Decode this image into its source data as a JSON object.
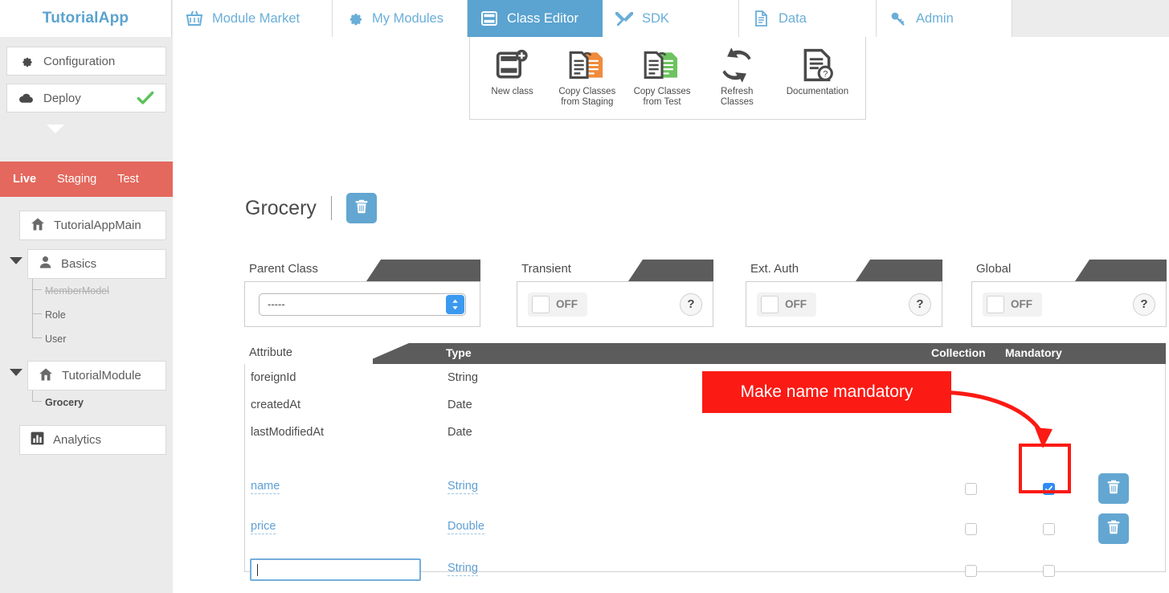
{
  "brand": {
    "name": "TutorialApp"
  },
  "tabs": [
    {
      "label": "Module Market",
      "icon": "basket-icon",
      "active": false
    },
    {
      "label": "My Modules",
      "icon": "gear-icon",
      "active": false
    },
    {
      "label": "Class Editor",
      "icon": "class-icon",
      "active": true
    },
    {
      "label": "SDK",
      "icon": "tools-icon",
      "active": false
    },
    {
      "label": "Data",
      "icon": "document-icon",
      "active": false
    },
    {
      "label": "Admin",
      "icon": "key-icon",
      "active": false
    }
  ],
  "sidebar": {
    "top_items": [
      {
        "label": "Configuration",
        "icon": "gear-icon"
      },
      {
        "label": "Deploy",
        "icon": "cloud-icon",
        "status_icon": "check-icon"
      }
    ],
    "environments": [
      {
        "label": "Live",
        "active": true
      },
      {
        "label": "Staging",
        "active": false
      },
      {
        "label": "Test",
        "active": false
      }
    ],
    "tree": [
      {
        "label": "TutorialAppMain",
        "icon": "home-icon",
        "expandable": false,
        "children": []
      },
      {
        "label": "Basics",
        "icon": "person-icon",
        "expandable": true,
        "children": [
          {
            "label": "MemberModel",
            "state": "disabled"
          },
          {
            "label": "Role",
            "state": "normal"
          },
          {
            "label": "User",
            "state": "normal"
          }
        ]
      },
      {
        "label": "TutorialModule",
        "icon": "home-icon",
        "expandable": true,
        "children": [
          {
            "label": "Grocery",
            "state": "selected"
          }
        ]
      },
      {
        "label": "Analytics",
        "icon": "chart-icon",
        "expandable": false,
        "children": []
      }
    ]
  },
  "toolbar": {
    "buttons": [
      {
        "label": "New class",
        "icon": "new-class-icon"
      },
      {
        "label": "Copy Classes\nfrom Staging",
        "line1": "Copy Classes",
        "line2": "from Staging",
        "icon": "copy-staging-icon"
      },
      {
        "label": "Copy Classes\nfrom Test",
        "line1": "Copy Classes",
        "line2": "from Test",
        "icon": "copy-test-icon"
      },
      {
        "label": "Refresh\nClasses",
        "line1": "Refresh",
        "line2": "Classes",
        "icon": "refresh-icon"
      },
      {
        "label": "Documentation",
        "line1": "Documentation",
        "line2": "",
        "icon": "documentation-icon"
      }
    ]
  },
  "main": {
    "class_title": "Grocery",
    "delete_class_icon": "trash-icon",
    "panels": [
      {
        "label": "Parent Class",
        "kind": "select",
        "value": "-----"
      },
      {
        "label": "Transient",
        "kind": "toggle",
        "value": "OFF",
        "help": "?"
      },
      {
        "label": "Ext. Auth",
        "kind": "toggle",
        "value": "OFF",
        "help": "?"
      },
      {
        "label": "Global",
        "kind": "toggle",
        "value": "OFF",
        "help": "?"
      }
    ],
    "table": {
      "headers": {
        "attribute": "Attribute",
        "type": "Type",
        "collection": "Collection",
        "mandatory": "Mandatory"
      },
      "rows": [
        {
          "attribute": "foreignId",
          "type": "String",
          "editable": false,
          "collection": null,
          "mandatory": null,
          "deletable": false
        },
        {
          "attribute": "createdAt",
          "type": "Date",
          "editable": false,
          "collection": null,
          "mandatory": null,
          "deletable": false
        },
        {
          "attribute": "lastModifiedAt",
          "type": "Date",
          "editable": false,
          "collection": null,
          "mandatory": null,
          "deletable": false
        },
        {
          "attribute": "name",
          "type": "String",
          "editable": true,
          "collection": false,
          "mandatory": true,
          "deletable": true
        },
        {
          "attribute": "price",
          "type": "Double",
          "editable": true,
          "collection": false,
          "mandatory": false,
          "deletable": true
        },
        {
          "attribute": "",
          "type": "String",
          "editable": true,
          "collection": false,
          "mandatory": false,
          "deletable": false,
          "is_input": true
        }
      ],
      "new_attribute_value": "",
      "new_attribute_placeholder": ""
    }
  },
  "annotation": {
    "text": "Make name mandatory",
    "color": "#fb1a14",
    "target": "mandatory-checkbox-name-row"
  },
  "colors": {
    "accent_blue": "#5ba3d0",
    "env_red": "#e4685d",
    "header_dark": "#5c5c5c",
    "annotation_red": "#fb1a14",
    "link_blue": "#5e9fd4",
    "check_blue": "#2e8bf5"
  }
}
